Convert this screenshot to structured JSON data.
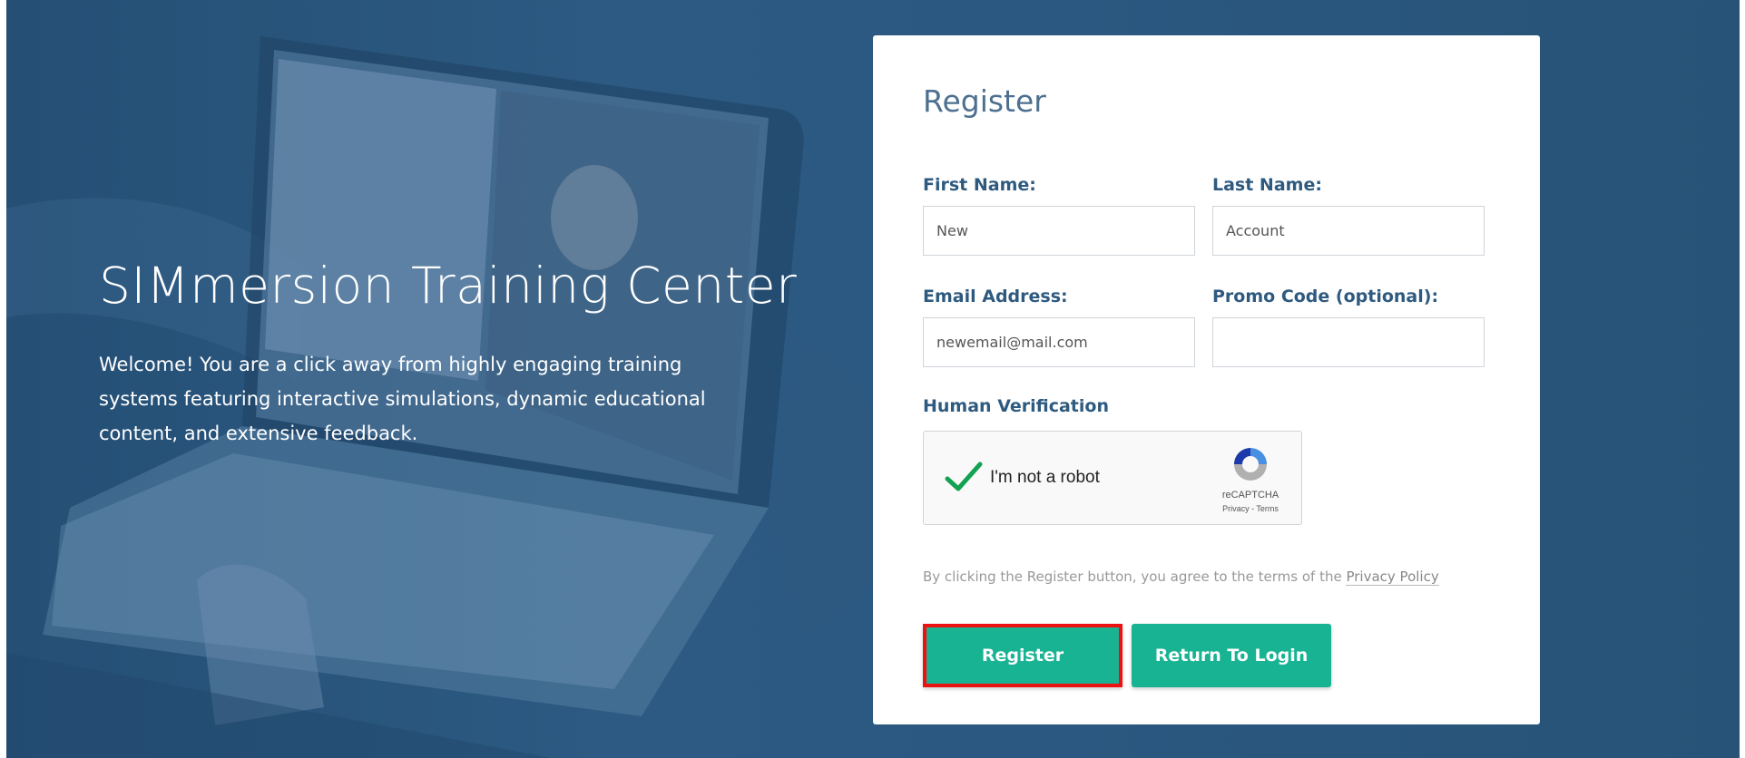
{
  "hero": {
    "title": "SIMmersion Training Center",
    "description": "Welcome! You are a click away from highly engaging training systems featuring interactive simulations, dynamic educational content, and extensive feedback."
  },
  "form": {
    "title": "Register",
    "first_name_label": "First Name:",
    "first_name_value": "New",
    "last_name_label": "Last Name:",
    "last_name_value": "Account",
    "email_label": "Email Address:",
    "email_value": "newemail@mail.com",
    "promo_label": "Promo Code (optional):",
    "promo_value": "",
    "verification_label": "Human Verification"
  },
  "captcha": {
    "label": "I'm not a robot",
    "brand": "reCAPTCHA",
    "links": "Privacy - Terms",
    "checked": true
  },
  "terms": {
    "text": "By clicking the Register button, you agree to the terms of the ",
    "link": "Privacy Policy"
  },
  "buttons": {
    "register": "Register",
    "return_login": "Return To Login"
  },
  "colors": {
    "accent_button": "#17b393",
    "label": "#2e5a7f",
    "highlight": "#ee1111"
  }
}
